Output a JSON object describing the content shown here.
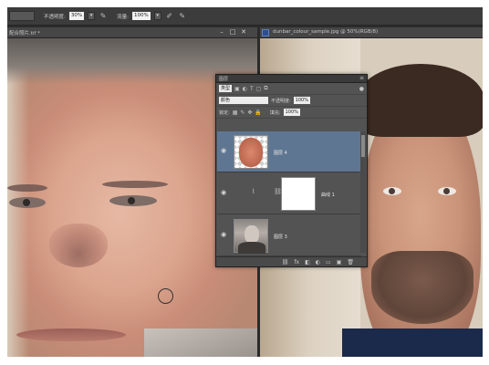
{
  "options_bar": {
    "opacity_label": "不透明度:",
    "opacity_value": "30%",
    "flow_label": "流量:",
    "flow_value": "100%"
  },
  "left_document": {
    "tab_label": "配合照片.tif *"
  },
  "right_document": {
    "tab_label": "dunbar_colour_sample.jpg @ 50%(RGB/8)"
  },
  "layers_panel": {
    "title": "图层",
    "filter_value": "类型",
    "blend_mode": "颜色",
    "opacity_label": "不透明度:",
    "opacity_value": "100%",
    "lock_label": "锁定:",
    "fill_label": "填充:",
    "fill_value": "100%",
    "layers": [
      {
        "name": "图层 4",
        "active": true
      },
      {
        "name": "曲线 1",
        "active": false
      },
      {
        "name": "图层 3",
        "active": false
      }
    ]
  },
  "colors": {
    "panel_bg": "#535353",
    "active_layer": "#5f7692",
    "options_bar": "#3c3c3c"
  }
}
